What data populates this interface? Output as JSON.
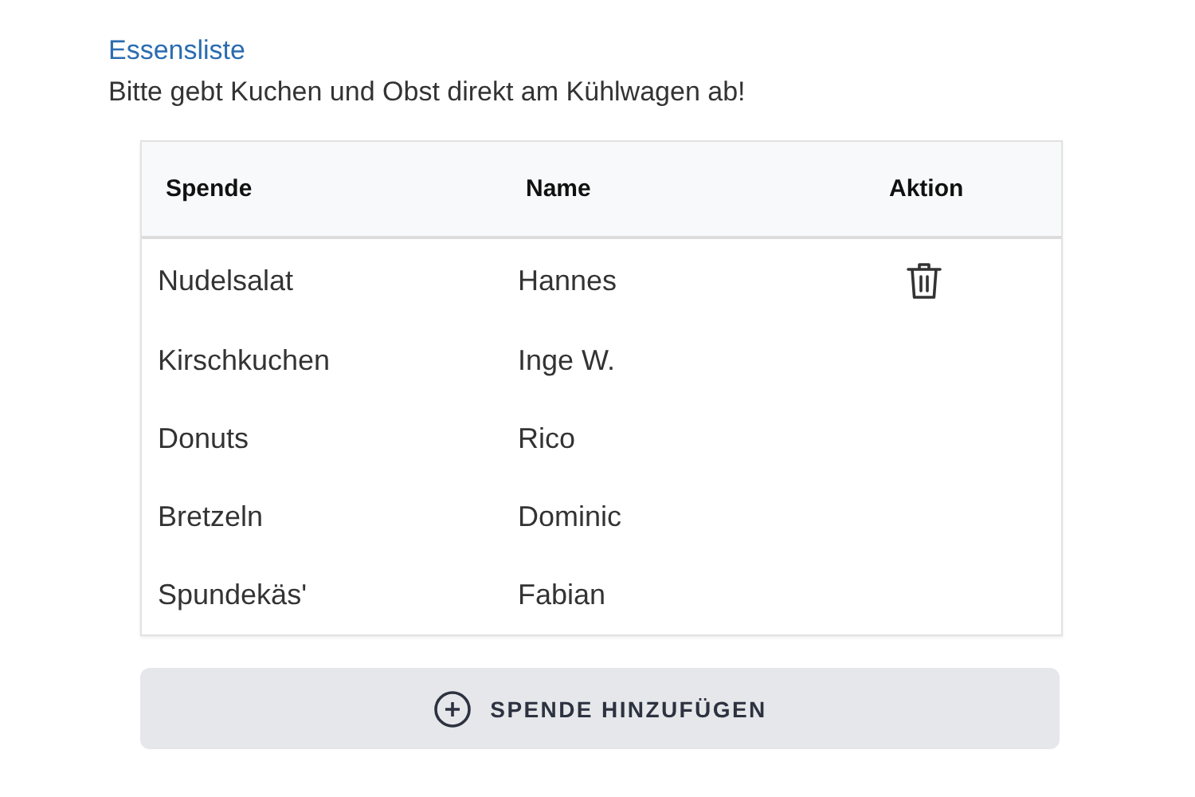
{
  "title": "Essensliste",
  "subtitle": "Bitte gebt Kuchen und Obst direkt am Kühlwagen ab!",
  "table": {
    "columns": [
      "Spende",
      "Name",
      "Aktion"
    ],
    "rows": [
      {
        "spende": "Nudelsalat",
        "name": "Hannes",
        "deletable": true
      },
      {
        "spende": "Kirschkuchen",
        "name": "Inge W.",
        "deletable": false
      },
      {
        "spende": "Donuts",
        "name": "Rico",
        "deletable": false
      },
      {
        "spende": "Bretzeln",
        "name": "Dominic",
        "deletable": false
      },
      {
        "spende": "Spundekäs'",
        "name": "Fabian",
        "deletable": false
      }
    ]
  },
  "add_button": "SPENDE HINZUFÜGEN"
}
